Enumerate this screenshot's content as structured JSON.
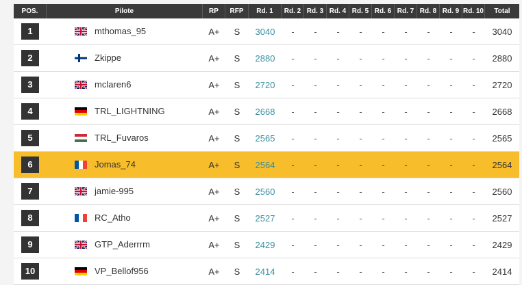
{
  "headers": {
    "pos": "POS.",
    "pilot": "Pilote",
    "rp": "RP",
    "rfp": "RFP",
    "rounds": [
      "Rd. 1",
      "Rd. 2",
      "Rd. 3",
      "Rd. 4",
      "Rd. 5",
      "Rd. 6",
      "Rd. 7",
      "Rd. 8",
      "Rd. 9",
      "Rd. 10"
    ],
    "total": "Total"
  },
  "dash": "-",
  "rows": [
    {
      "pos": "1",
      "flag": "uk",
      "name": "mthomas_95",
      "rp": "A+",
      "rfp": "S",
      "rd1": "3040",
      "total": "3040",
      "highlight": false
    },
    {
      "pos": "2",
      "flag": "finland",
      "name": "Zkippe",
      "rp": "A+",
      "rfp": "S",
      "rd1": "2880",
      "total": "2880",
      "highlight": false
    },
    {
      "pos": "3",
      "flag": "uk",
      "name": "mclaren6",
      "rp": "A+",
      "rfp": "S",
      "rd1": "2720",
      "total": "2720",
      "highlight": false
    },
    {
      "pos": "4",
      "flag": "germany",
      "name": "TRL_LIGHTNING",
      "rp": "A+",
      "rfp": "S",
      "rd1": "2668",
      "total": "2668",
      "highlight": false
    },
    {
      "pos": "5",
      "flag": "hungary",
      "name": "TRL_Fuvaros",
      "rp": "A+",
      "rfp": "S",
      "rd1": "2565",
      "total": "2565",
      "highlight": false
    },
    {
      "pos": "6",
      "flag": "france",
      "name": "Jomas_74",
      "rp": "A+",
      "rfp": "S",
      "rd1": "2564",
      "total": "2564",
      "highlight": true
    },
    {
      "pos": "7",
      "flag": "uk",
      "name": "jamie-995",
      "rp": "A+",
      "rfp": "S",
      "rd1": "2560",
      "total": "2560",
      "highlight": false
    },
    {
      "pos": "8",
      "flag": "france",
      "name": "RC_Atho",
      "rp": "A+",
      "rfp": "S",
      "rd1": "2527",
      "total": "2527",
      "highlight": false
    },
    {
      "pos": "9",
      "flag": "uk",
      "name": "GTP_Aderrrm",
      "rp": "A+",
      "rfp": "S",
      "rd1": "2429",
      "total": "2429",
      "highlight": false
    },
    {
      "pos": "10",
      "flag": "germany",
      "name": "VP_Bellof956",
      "rp": "A+",
      "rfp": "S",
      "rd1": "2414",
      "total": "2414",
      "highlight": false
    }
  ],
  "colors": {
    "header_bg": "#3a3a3a",
    "highlight_row": "#f7bd2b",
    "rd1_text": "#3a8fa1",
    "badge_bg": "#333333"
  }
}
